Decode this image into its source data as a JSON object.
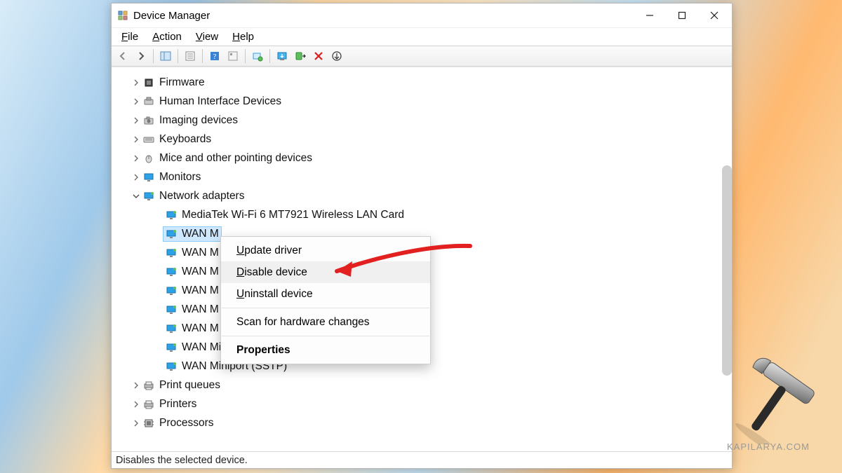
{
  "window": {
    "title": "Device Manager"
  },
  "menus": {
    "file": "File",
    "action": "Action",
    "view": "View",
    "help": "Help"
  },
  "tree": {
    "firmware": "Firmware",
    "hid": "Human Interface Devices",
    "imaging": "Imaging devices",
    "keyboards": "Keyboards",
    "mice": "Mice and other pointing devices",
    "monitors": "Monitors",
    "netadapters": "Network adapters",
    "mediatek": "MediaTek Wi-Fi 6 MT7921 Wireless LAN Card",
    "wan_sel": "WAN M",
    "wan2": "WAN M",
    "wan3": "WAN M",
    "wan4": "WAN M",
    "wan5": "WAN M",
    "wan6": "WAN M",
    "wan_pptp": "WAN Miniport (PPTP)",
    "wan_sstp": "WAN Miniport (SSTP)",
    "printqueues": "Print queues",
    "printers": "Printers",
    "processors": "Processors"
  },
  "context_menu": {
    "update": "pdate driver",
    "disable": "isable device",
    "uninstall": "ninstall device",
    "scan": "Scan for hardware changes",
    "properties": "Properties"
  },
  "statusbar": {
    "text": "Disables the selected device."
  },
  "watermark": {
    "text": "KAPILARYA.COM"
  }
}
